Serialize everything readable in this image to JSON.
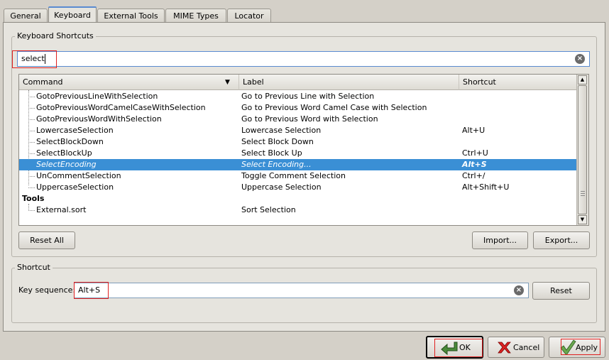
{
  "tabs": [
    {
      "label": "General",
      "active": false
    },
    {
      "label": "Keyboard",
      "active": true
    },
    {
      "label": "External Tools",
      "active": false
    },
    {
      "label": "MIME Types",
      "active": false
    },
    {
      "label": "Locator",
      "active": false
    }
  ],
  "shortcuts_group": {
    "title": "Keyboard Shortcuts",
    "filter_value": "select",
    "columns": [
      "Command",
      "Label",
      "Shortcut"
    ],
    "rows": [
      {
        "command": "GotoPreviousLineWithSelection",
        "label": "Go to Previous Line with Selection",
        "shortcut": ""
      },
      {
        "command": "GotoPreviousWordCamelCaseWithSelection",
        "label": "Go to Previous Word Camel Case with Selection",
        "shortcut": ""
      },
      {
        "command": "GotoPreviousWordWithSelection",
        "label": "Go to Previous Word with Selection",
        "shortcut": ""
      },
      {
        "command": "LowercaseSelection",
        "label": "Lowercase Selection",
        "shortcut": "Alt+U"
      },
      {
        "command": "SelectBlockDown",
        "label": "Select Block Down",
        "shortcut": ""
      },
      {
        "command": "SelectBlockUp",
        "label": "Select Block Up",
        "shortcut": "Ctrl+U"
      },
      {
        "command": "SelectEncoding",
        "label": "Select Encoding...",
        "shortcut": "Alt+S",
        "selected": true
      },
      {
        "command": "UnCommentSelection",
        "label": "Toggle Comment Selection",
        "shortcut": "Ctrl+/"
      },
      {
        "command": "UppercaseSelection",
        "label": "Uppercase Selection",
        "shortcut": "Alt+Shift+U"
      }
    ],
    "category": "Tools",
    "category_rows": [
      {
        "command": "External.sort",
        "label": "Sort Selection",
        "shortcut": ""
      }
    ],
    "reset_all_label": "Reset All",
    "import_label": "Import...",
    "export_label": "Export..."
  },
  "shortcut_group": {
    "title": "Shortcut",
    "key_sequence_label": "Key sequence:",
    "key_sequence_value": "Alt+S",
    "reset_label": "Reset"
  },
  "dialog_buttons": {
    "ok": "OK",
    "cancel": "Cancel",
    "apply": "Apply"
  },
  "colors": {
    "selection": "#3a8fd5",
    "highlight_box": "#e02020"
  }
}
